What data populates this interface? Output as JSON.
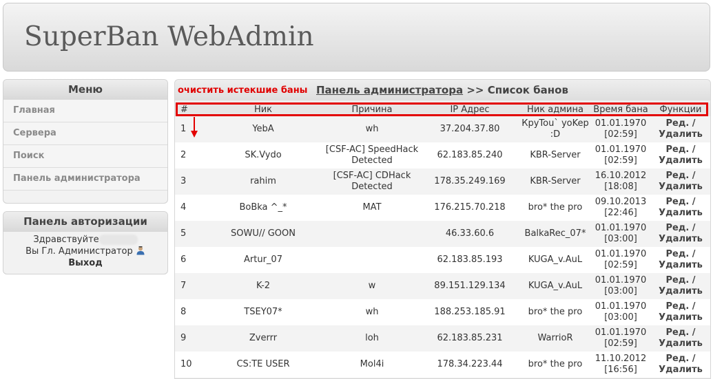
{
  "header": {
    "title": "SuperBan WebAdmin"
  },
  "menu": {
    "title": "Меню",
    "items": [
      {
        "label": "Главная"
      },
      {
        "label": "Сервера"
      },
      {
        "label": "Поиск"
      },
      {
        "label": "Панель администратора"
      }
    ]
  },
  "auth": {
    "title": "Панель авторизации",
    "greeting": "Здравствуйте",
    "role": "Вы Гл. Администратор",
    "logout": "Выход"
  },
  "panel": {
    "purge_link": "очистить истекшие баны",
    "breadcrumb_link": "Панель администратора",
    "breadcrumb_sep": ">>",
    "breadcrumb_current": "Список банов"
  },
  "table": {
    "headers": {
      "num": "#",
      "nick": "Ник",
      "reason": "Причина",
      "ip": "IP Адрес",
      "admin": "Ник админа",
      "time": "Время бана",
      "functions": "Функции"
    },
    "edit_label": "Ред. /",
    "delete_label": "Удалить",
    "rows": [
      {
        "num": "1",
        "nick": "YebA",
        "reason": "wh",
        "ip": "37.204.37.80",
        "admin": "КруTou` yoKep :D",
        "date": "01.01.1970",
        "time": "[02:59]"
      },
      {
        "num": "2",
        "nick": "SK.Vydo",
        "reason": "[CSF-AC] SpeedHack Detected",
        "ip": "62.183.85.240",
        "admin": "KBR-Server",
        "date": "01.01.1970",
        "time": "[02:59]"
      },
      {
        "num": "3",
        "nick": "rahim",
        "reason": "[CSF-AC] CDHack Detected",
        "ip": "178.35.249.169",
        "admin": "KBR-Server",
        "date": "16.10.2012",
        "time": "[18:08]"
      },
      {
        "num": "4",
        "nick": "BoBka ^_*",
        "reason": "MAT",
        "ip": "176.215.70.218",
        "admin": "bro* the pro",
        "date": "09.10.2013",
        "time": "[22:46]"
      },
      {
        "num": "5",
        "nick": "SOWU// GOON",
        "reason": "",
        "ip": "46.33.60.6",
        "admin": "BalkaRec_07*",
        "date": "01.01.1970",
        "time": "[03:00]"
      },
      {
        "num": "6",
        "nick": "Artur_07",
        "reason": "",
        "ip": "62.183.85.193",
        "admin": "KUGA_v.AuL",
        "date": "01.01.1970",
        "time": "[02:59]"
      },
      {
        "num": "7",
        "nick": "K-2",
        "reason": "w",
        "ip": "89.151.129.134",
        "admin": "KUGA_v.AuL",
        "date": "01.01.1970",
        "time": "[03:00]"
      },
      {
        "num": "8",
        "nick": "TSEY07*",
        "reason": "wh",
        "ip": "188.253.185.91",
        "admin": "bro* the pro",
        "date": "01.01.1970",
        "time": "[03:00]"
      },
      {
        "num": "9",
        "nick": "Zverrr",
        "reason": "loh",
        "ip": "62.183.85.231",
        "admin": "WarrioR",
        "date": "01.01.1970",
        "time": "[02:59]"
      },
      {
        "num": "10",
        "nick": "CS:TE USER",
        "reason": "Mol4i",
        "ip": "178.34.223.44",
        "admin": "bro* the pro",
        "date": "11.10.2012",
        "time": "[16:56]"
      }
    ]
  },
  "colors": {
    "highlight": "#e30000",
    "purge_link": "#e00000"
  }
}
